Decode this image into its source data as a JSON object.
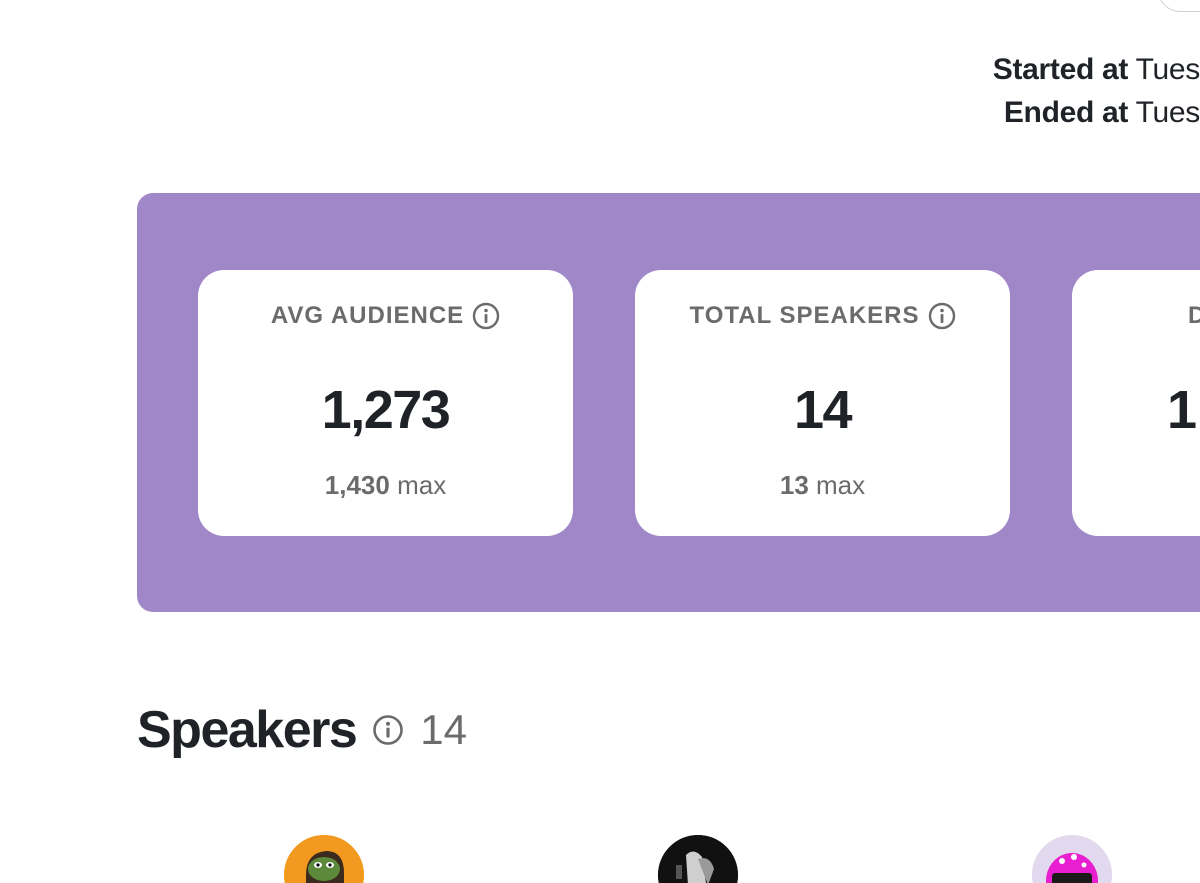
{
  "times": {
    "started_label": "Started at",
    "started_value": "Tues",
    "ended_label": "Ended at",
    "ended_value": "Tues"
  },
  "stats": [
    {
      "title": "AVG AUDIENCE",
      "value": "1,273",
      "sub_value": "1,430",
      "sub_label": "max"
    },
    {
      "title": "TOTAL SPEAKERS",
      "value": "14",
      "sub_value": "13",
      "sub_label": "max"
    },
    {
      "title": "D",
      "value": "1",
      "sub_value": "",
      "sub_label": ""
    }
  ],
  "speakers": {
    "title": "Speakers",
    "count": "14"
  },
  "avatars": [
    {
      "name": "speaker-avatar-1",
      "color": "#f29a1f"
    },
    {
      "name": "speaker-avatar-2",
      "color": "#111111"
    },
    {
      "name": "speaker-avatar-3",
      "color": "#e3d9ef"
    }
  ],
  "colors": {
    "panel": "#a088c8",
    "card": "#ffffff",
    "text_dark": "#1f2328",
    "text_muted": "#6b6b6b"
  }
}
